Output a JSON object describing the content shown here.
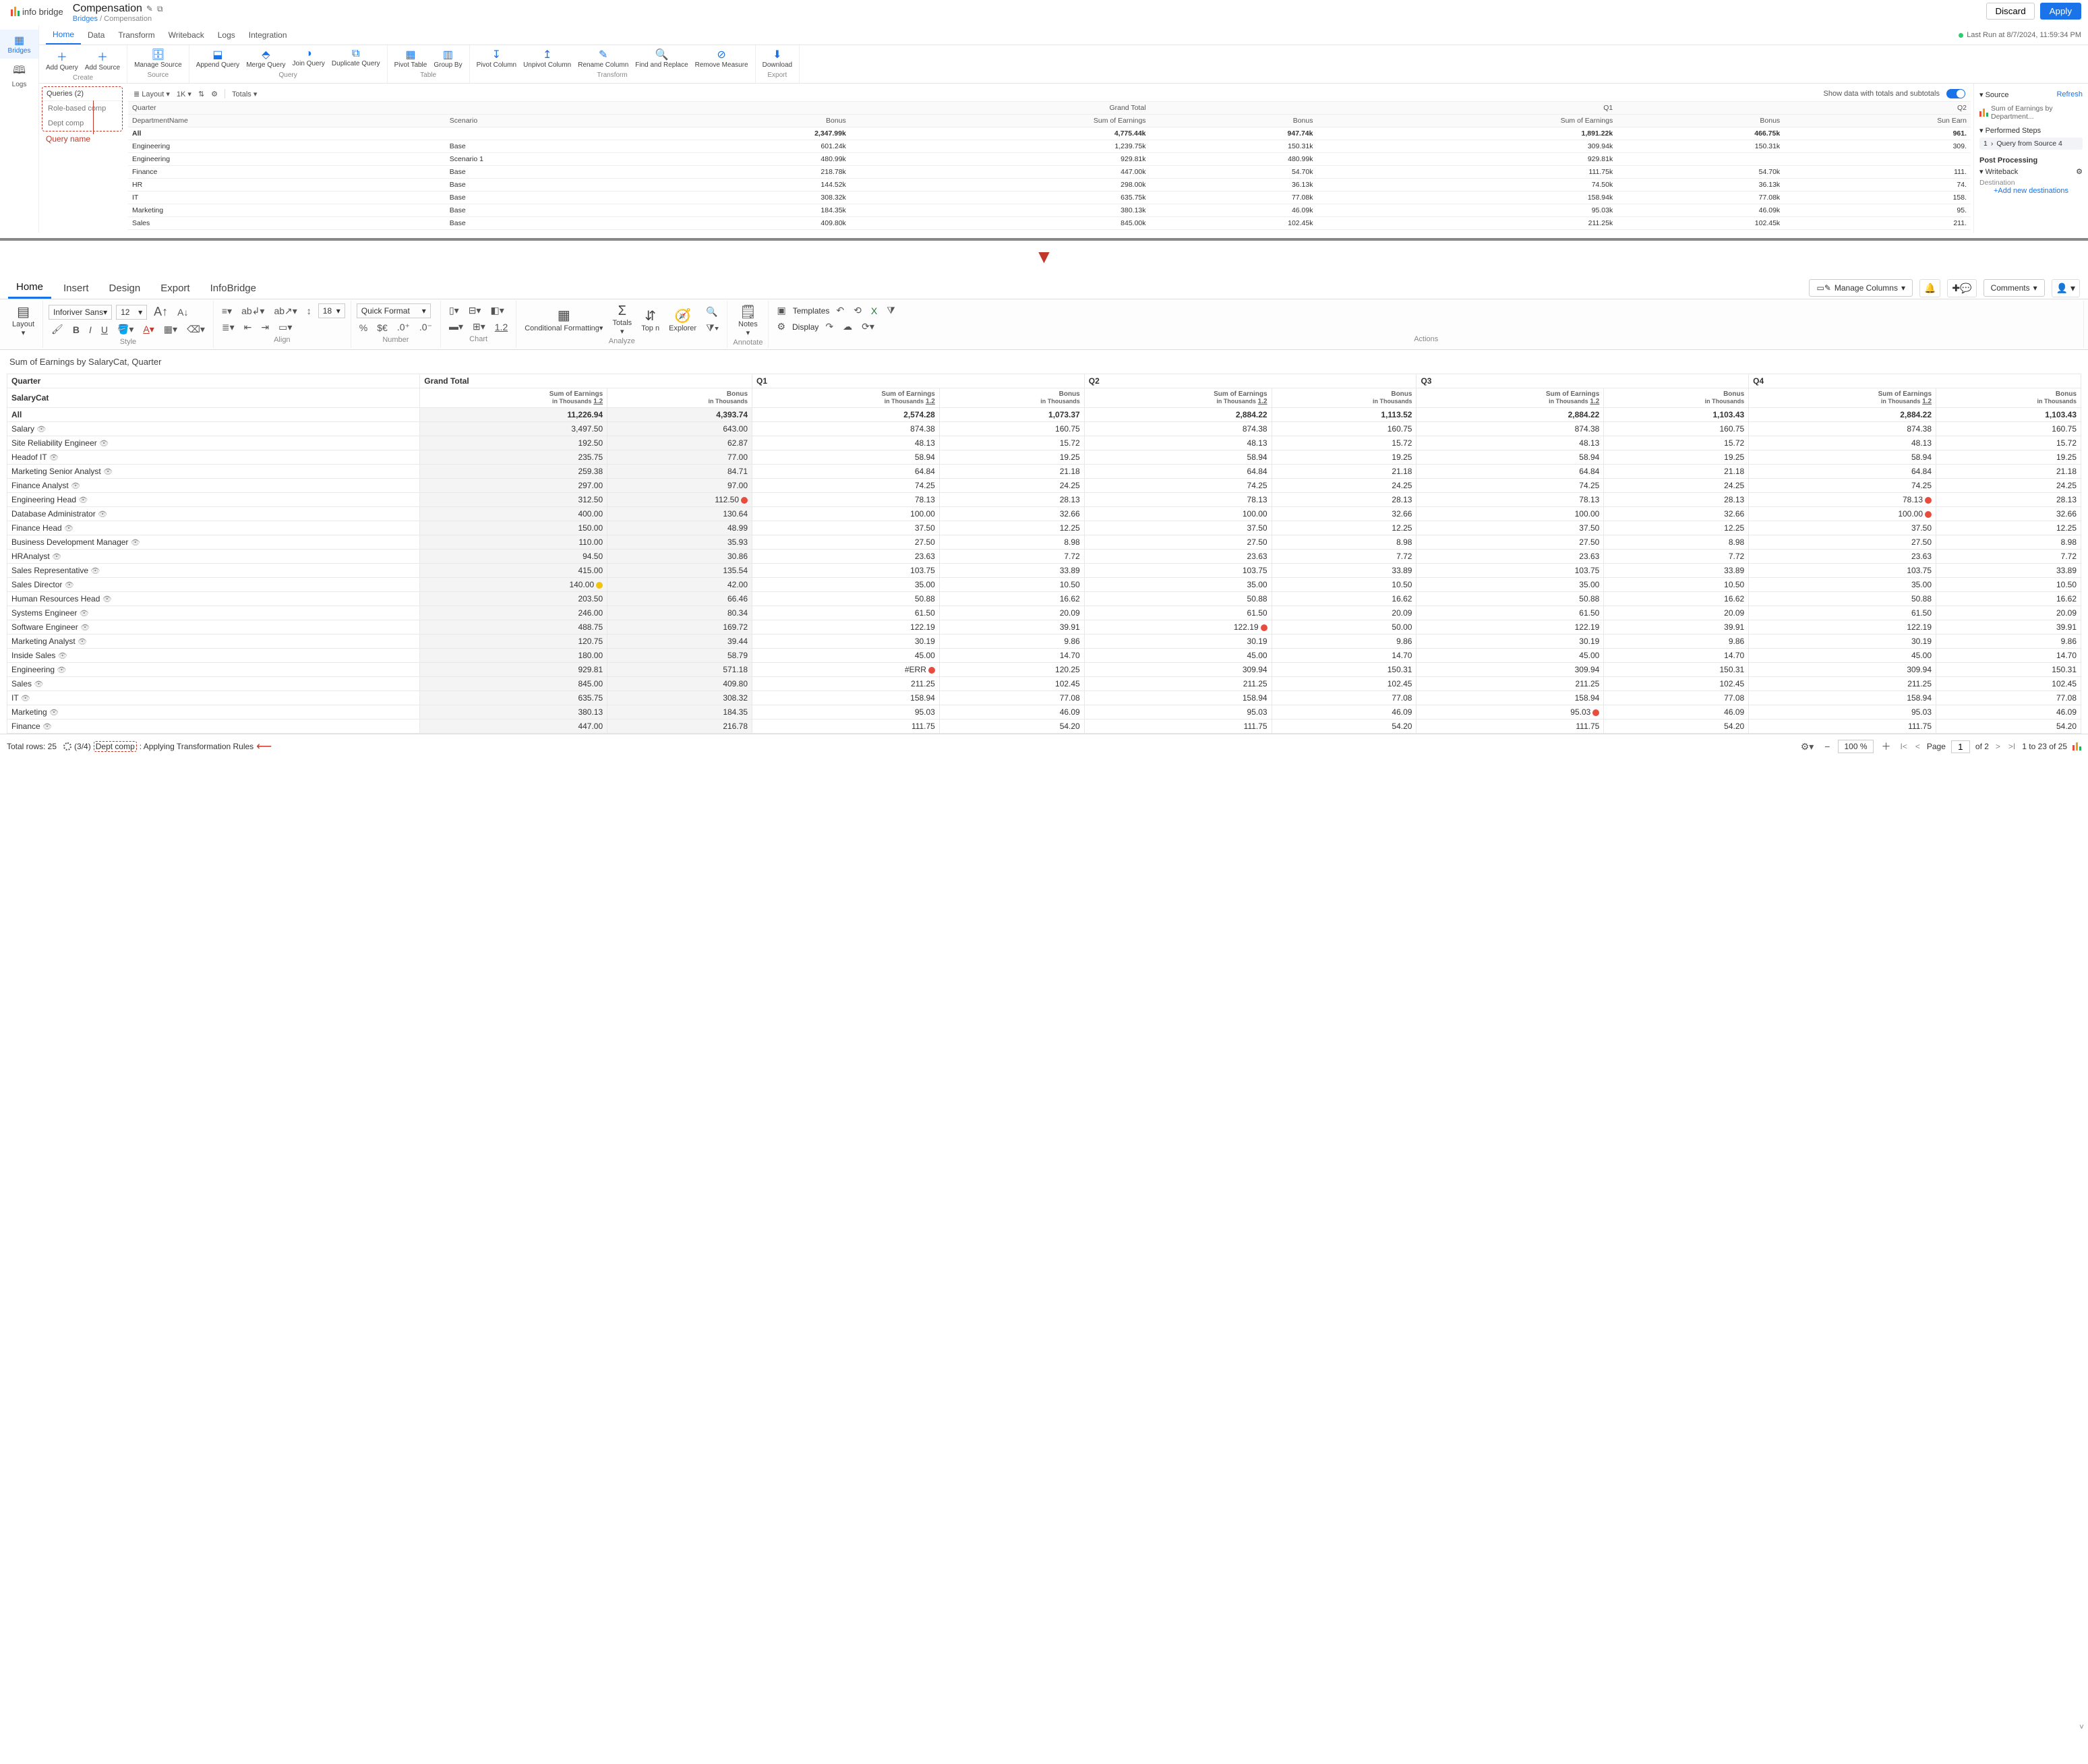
{
  "top": {
    "logo": "info bridge",
    "title": "Compensation",
    "breadcrumb_link": "Bridges",
    "breadcrumb_tail": " / Compensation",
    "discard": "Discard",
    "apply": "Apply",
    "rail": {
      "bridges": "Bridges",
      "logs": "Logs"
    },
    "tabs": [
      "Home",
      "Data",
      "Transform",
      "Writeback",
      "Logs",
      "Integration"
    ],
    "lastrun": "Last Run at 8/7/2024, 11:59:34 PM",
    "ribbon": {
      "create": {
        "label": "Create",
        "items": [
          "Add Query",
          "Add Source"
        ]
      },
      "source": {
        "label": "Source",
        "items": [
          "Manage Source"
        ]
      },
      "query": {
        "label": "Query",
        "items": [
          "Append Query",
          "Merge Query",
          "Join Query",
          "Duplicate Query"
        ]
      },
      "table": {
        "label": "Table",
        "items": [
          "Pivot Table",
          "Group By"
        ]
      },
      "transform": {
        "label": "Transform",
        "items": [
          "Pivot Column",
          "Unpivot Column",
          "Rename Column",
          "Find and Replace",
          "Remove Measure"
        ]
      },
      "export": {
        "label": "Export",
        "items": [
          "Download"
        ]
      }
    },
    "queries": {
      "header": "Queries  (2)",
      "items": [
        "Role-based comp",
        "Dept comp"
      ],
      "callout": "Query name"
    },
    "grid_toolbar": {
      "layout": "Layout",
      "rowlimit": "1K",
      "totals": "Totals",
      "toggle_label": "Show data with totals and subtotals"
    },
    "grid": {
      "quarter_label": "Quarter",
      "dept_label": "DepartmentName",
      "scenario_label": "Scenario",
      "gt": "Grand Total",
      "q1": "Q1",
      "q2": "Q2",
      "bonus": "Bonus",
      "soe": "Sum of Earnings",
      "sum_short": "Sun Earn",
      "rows": [
        {
          "dept": "All",
          "sc": "",
          "gt_b": "2,347.99k",
          "gt_e": "4,775.44k",
          "q1_b": "947.74k",
          "q1_e": "1,891.22k",
          "q2_b": "466.75k",
          "q2_e": "961."
        },
        {
          "dept": "Engineering",
          "sc": "Base",
          "gt_b": "601.24k",
          "gt_e": "1,239.75k",
          "q1_b": "150.31k",
          "q1_e": "309.94k",
          "q2_b": "150.31k",
          "q2_e": "309."
        },
        {
          "dept": "Engineering",
          "sc": "Scenario 1",
          "gt_b": "480.99k",
          "gt_e": "929.81k",
          "q1_b": "480.99k",
          "q1_e": "929.81k",
          "q2_b": "",
          "q2_e": ""
        },
        {
          "dept": "Finance",
          "sc": "Base",
          "gt_b": "218.78k",
          "gt_e": "447.00k",
          "q1_b": "54.70k",
          "q1_e": "111.75k",
          "q2_b": "54.70k",
          "q2_e": "111."
        },
        {
          "dept": "HR",
          "sc": "Base",
          "gt_b": "144.52k",
          "gt_e": "298.00k",
          "q1_b": "36.13k",
          "q1_e": "74.50k",
          "q2_b": "36.13k",
          "q2_e": "74."
        },
        {
          "dept": "IT",
          "sc": "Base",
          "gt_b": "308.32k",
          "gt_e": "635.75k",
          "q1_b": "77.08k",
          "q1_e": "158.94k",
          "q2_b": "77.08k",
          "q2_e": "158."
        },
        {
          "dept": "Marketing",
          "sc": "Base",
          "gt_b": "184.35k",
          "gt_e": "380.13k",
          "q1_b": "46.09k",
          "q1_e": "95.03k",
          "q2_b": "46.09k",
          "q2_e": "95."
        },
        {
          "dept": "Sales",
          "sc": "Base",
          "gt_b": "409.80k",
          "gt_e": "845.00k",
          "q1_b": "102.45k",
          "q1_e": "211.25k",
          "q2_b": "102.45k",
          "q2_e": "211."
        }
      ]
    },
    "right": {
      "source": "Source",
      "refresh": "Refresh",
      "source_name": "Sum of Earnings by Department...",
      "steps": "Performed Steps",
      "step1_num": "1",
      "step1": "Query from Source 4",
      "post": "Post Processing",
      "writeback": "Writeback",
      "dest": "Destination",
      "add": "+Add new destinations"
    }
  },
  "bottom": {
    "tabs": [
      "Home",
      "Insert",
      "Design",
      "Export",
      "InfoBridge"
    ],
    "manage_cols": "Manage Columns",
    "comments": "Comments",
    "ribbon": {
      "layout": "Layout",
      "font": "Inforiver Sans",
      "size": "12",
      "style_label": "Style",
      "align_label": "Align",
      "indent": "18",
      "number_label": "Number",
      "quickfmt": "Quick Format",
      "chart_label": "Chart",
      "chartscale": "1.2",
      "analyze_label": "Analyze",
      "cond": "Conditional Formatting",
      "totals": "Totals",
      "topn": "Top n",
      "explorer": "Explorer",
      "annotate_label": "Annotate",
      "notes": "Notes",
      "actions_label": "Actions",
      "templates": "Templates",
      "display": "Display"
    },
    "chart_title": "Sum of Earnings by SalaryCat, Quarter",
    "pivot": {
      "quarter": "Quarter",
      "salarycat": "SalaryCat",
      "gt": "Grand Total",
      "cols": [
        "Q1",
        "Q2",
        "Q3",
        "Q4"
      ],
      "sub_e": "Sum of Earnings",
      "sub_b": "Bonus",
      "unit": "in Thousands",
      "scale": "1.2",
      "all": {
        "label": "All",
        "gt_e": "11,226.94",
        "gt_b": "4,393.74",
        "q1_e": "2,574.28",
        "q1_b": "1,073.37",
        "q2_e": "2,884.22",
        "q2_b": "1,113.52",
        "q3_e": "2,884.22",
        "q3_b": "1,103.43",
        "q4_e": "2,884.22",
        "q4_b": "1,103.43"
      },
      "rows": [
        {
          "cat": "Salary",
          "gt_e": "3,497.50",
          "gt_b": "643.00",
          "q1_e": "874.38",
          "q1_b": "160.75",
          "q2_e": "874.38",
          "q2_b": "160.75",
          "q3_e": "874.38",
          "q3_b": "160.75",
          "q4_e": "874.38",
          "q4_b": "160.75"
        },
        {
          "cat": "Site Reliability Engineer",
          "gt_e": "192.50",
          "gt_b": "62.87",
          "q1_e": "48.13",
          "q1_b": "15.72",
          "q2_e": "48.13",
          "q2_b": "15.72",
          "q3_e": "48.13",
          "q3_b": "15.72",
          "q4_e": "48.13",
          "q4_b": "15.72"
        },
        {
          "cat": "Headof IT",
          "gt_e": "235.75",
          "gt_b": "77.00",
          "q1_e": "58.94",
          "q1_b": "19.25",
          "q2_e": "58.94",
          "q2_b": "19.25",
          "q3_e": "58.94",
          "q3_b": "19.25",
          "q4_e": "58.94",
          "q4_b": "19.25"
        },
        {
          "cat": "Marketing Senior Analyst",
          "gt_e": "259.38",
          "gt_b": "84.71",
          "q1_e": "64.84",
          "q1_b": "21.18",
          "q2_e": "64.84",
          "q2_b": "21.18",
          "q3_e": "64.84",
          "q3_b": "21.18",
          "q4_e": "64.84",
          "q4_b": "21.18"
        },
        {
          "cat": "Finance Analyst",
          "gt_e": "297.00",
          "gt_b": "97.00",
          "q1_e": "74.25",
          "q1_b": "24.25",
          "q2_e": "74.25",
          "q2_b": "24.25",
          "q3_e": "74.25",
          "q3_b": "24.25",
          "q4_e": "74.25",
          "q4_b": "24.25"
        },
        {
          "cat": "Engineering Head",
          "gt_e": "312.50",
          "gt_b": "112.50",
          "q1_e": "78.13",
          "q1_b": "28.13",
          "q2_e": "78.13",
          "q2_b": "28.13",
          "q3_e": "78.13",
          "q3_b": "28.13",
          "q4_e": "78.13",
          "q4_b": "28.13",
          "w_gt_b": "r",
          "w_q4_e": "r"
        },
        {
          "cat": "Database Administrator",
          "gt_e": "400.00",
          "gt_b": "130.64",
          "q1_e": "100.00",
          "q1_b": "32.66",
          "q2_e": "100.00",
          "q2_b": "32.66",
          "q3_e": "100.00",
          "q3_b": "32.66",
          "q4_e": "100.00",
          "q4_b": "32.66",
          "w_q4_e": "r"
        },
        {
          "cat": "Finance Head",
          "gt_e": "150.00",
          "gt_b": "48.99",
          "q1_e": "37.50",
          "q1_b": "12.25",
          "q2_e": "37.50",
          "q2_b": "12.25",
          "q3_e": "37.50",
          "q3_b": "12.25",
          "q4_e": "37.50",
          "q4_b": "12.25"
        },
        {
          "cat": "Business Development Manager",
          "gt_e": "110.00",
          "gt_b": "35.93",
          "q1_e": "27.50",
          "q1_b": "8.98",
          "q2_e": "27.50",
          "q2_b": "8.98",
          "q3_e": "27.50",
          "q3_b": "8.98",
          "q4_e": "27.50",
          "q4_b": "8.98"
        },
        {
          "cat": "HRAnalyst",
          "gt_e": "94.50",
          "gt_b": "30.86",
          "q1_e": "23.63",
          "q1_b": "7.72",
          "q2_e": "23.63",
          "q2_b": "7.72",
          "q3_e": "23.63",
          "q3_b": "7.72",
          "q4_e": "23.63",
          "q4_b": "7.72"
        },
        {
          "cat": "Sales Representative",
          "gt_e": "415.00",
          "gt_b": "135.54",
          "q1_e": "103.75",
          "q1_b": "33.89",
          "q2_e": "103.75",
          "q2_b": "33.89",
          "q3_e": "103.75",
          "q3_b": "33.89",
          "q4_e": "103.75",
          "q4_b": "33.89"
        },
        {
          "cat": "Sales Director",
          "gt_e": "140.00",
          "gt_b": "42.00",
          "q1_e": "35.00",
          "q1_b": "10.50",
          "q2_e": "35.00",
          "q2_b": "10.50",
          "q3_e": "35.00",
          "q3_b": "10.50",
          "q4_e": "35.00",
          "q4_b": "10.50",
          "w_gt_e": "y"
        },
        {
          "cat": "Human Resources Head",
          "gt_e": "203.50",
          "gt_b": "66.46",
          "q1_e": "50.88",
          "q1_b": "16.62",
          "q2_e": "50.88",
          "q2_b": "16.62",
          "q3_e": "50.88",
          "q3_b": "16.62",
          "q4_e": "50.88",
          "q4_b": "16.62"
        },
        {
          "cat": "Systems Engineer",
          "gt_e": "246.00",
          "gt_b": "80.34",
          "q1_e": "61.50",
          "q1_b": "20.09",
          "q2_e": "61.50",
          "q2_b": "20.09",
          "q3_e": "61.50",
          "q3_b": "20.09",
          "q4_e": "61.50",
          "q4_b": "20.09"
        },
        {
          "cat": "Software Engineer",
          "gt_e": "488.75",
          "gt_b": "169.72",
          "q1_e": "122.19",
          "q1_b": "39.91",
          "q2_e": "122.19",
          "q2_b": "50.00",
          "q3_e": "122.19",
          "q3_b": "39.91",
          "q4_e": "122.19",
          "q4_b": "39.91",
          "w_q2_e": "r"
        },
        {
          "cat": "Marketing Analyst",
          "gt_e": "120.75",
          "gt_b": "39.44",
          "q1_e": "30.19",
          "q1_b": "9.86",
          "q2_e": "30.19",
          "q2_b": "9.86",
          "q3_e": "30.19",
          "q3_b": "9.86",
          "q4_e": "30.19",
          "q4_b": "9.86"
        },
        {
          "cat": "Inside Sales",
          "gt_e": "180.00",
          "gt_b": "58.79",
          "q1_e": "45.00",
          "q1_b": "14.70",
          "q2_e": "45.00",
          "q2_b": "14.70",
          "q3_e": "45.00",
          "q3_b": "14.70",
          "q4_e": "45.00",
          "q4_b": "14.70"
        },
        {
          "cat": "Engineering",
          "gt_e": "929.81",
          "gt_b": "571.18",
          "q1_e": "#ERR",
          "q1_b": "120.25",
          "q2_e": "309.94",
          "q2_b": "150.31",
          "q3_e": "309.94",
          "q3_b": "150.31",
          "q4_e": "309.94",
          "q4_b": "150.31",
          "w_q1_e": "r"
        },
        {
          "cat": "Sales",
          "gt_e": "845.00",
          "gt_b": "409.80",
          "q1_e": "211.25",
          "q1_b": "102.45",
          "q2_e": "211.25",
          "q2_b": "102.45",
          "q3_e": "211.25",
          "q3_b": "102.45",
          "q4_e": "211.25",
          "q4_b": "102.45"
        },
        {
          "cat": "IT",
          "gt_e": "635.75",
          "gt_b": "308.32",
          "q1_e": "158.94",
          "q1_b": "77.08",
          "q2_e": "158.94",
          "q2_b": "77.08",
          "q3_e": "158.94",
          "q3_b": "77.08",
          "q4_e": "158.94",
          "q4_b": "77.08"
        },
        {
          "cat": "Marketing",
          "gt_e": "380.13",
          "gt_b": "184.35",
          "q1_e": "95.03",
          "q1_b": "46.09",
          "q2_e": "95.03",
          "q2_b": "46.09",
          "q3_e": "95.03",
          "q3_b": "46.09",
          "q4_e": "95.03",
          "q4_b": "46.09",
          "w_q3_e": "r"
        },
        {
          "cat": "Finance",
          "gt_e": "447.00",
          "gt_b": "216.78",
          "q1_e": "111.75",
          "q1_b": "54.20",
          "q2_e": "111.75",
          "q2_b": "54.20",
          "q3_e": "111.75",
          "q3_b": "54.20",
          "q4_e": "111.75",
          "q4_b": "54.20"
        }
      ]
    },
    "footer": {
      "total_rows": "Total rows: 25",
      "progress": "(3/4)",
      "qname": "Dept comp",
      "status_tail": ": Applying Transformation Rules",
      "zoom": "100 %",
      "page_label": "Page",
      "page_val": "1",
      "page_of": "of 2",
      "rows_range": "1 to 23  of 25"
    }
  }
}
